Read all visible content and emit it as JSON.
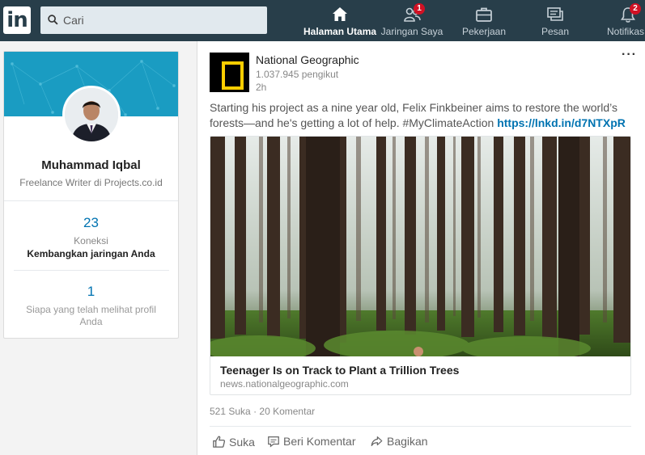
{
  "nav": {
    "logo_text": "in",
    "search_placeholder": "Cari",
    "items": [
      {
        "label": "Halaman Utama",
        "icon": "home-icon",
        "active": true
      },
      {
        "label": "Jaringan Saya",
        "icon": "people-icon",
        "badge": "1"
      },
      {
        "label": "Pekerjaan",
        "icon": "briefcase-icon"
      },
      {
        "label": "Pesan",
        "icon": "messages-icon"
      },
      {
        "label": "Notifikas",
        "icon": "bell-icon",
        "badge": "2"
      }
    ]
  },
  "profile": {
    "name": "Muhammad Iqbal",
    "headline": "Freelance Writer di Projects.co.id",
    "connections_count": "23",
    "connections_label": "Koneksi",
    "connections_cta": "Kembangkan jaringan Anda",
    "viewers_count": "1",
    "viewers_label": "Siapa yang telah melihat profil Anda"
  },
  "post": {
    "author": "National Geographic",
    "followers": "1.037.945 pengikut",
    "time": "2h",
    "more_label": "···",
    "text": "Starting his project as a nine year old, Felix Finkbeiner aims to restore the world’s forests—and he's getting a lot of help. #MyClimateAction ",
    "link": "https://lnkd.in/d7NTXpR",
    "article_title": "Teenager Is on Track to Plant a Trillion Trees",
    "article_source": "news.nationalgeographic.com",
    "likes": "521 Suka",
    "comments": "20 Komentar",
    "actions": {
      "like": "Suka",
      "comment": "Beri Komentar",
      "share": "Bagikan"
    }
  },
  "colors": {
    "nav_bg": "#283e4a",
    "accent": "#0073b1",
    "badge": "#d11124"
  }
}
